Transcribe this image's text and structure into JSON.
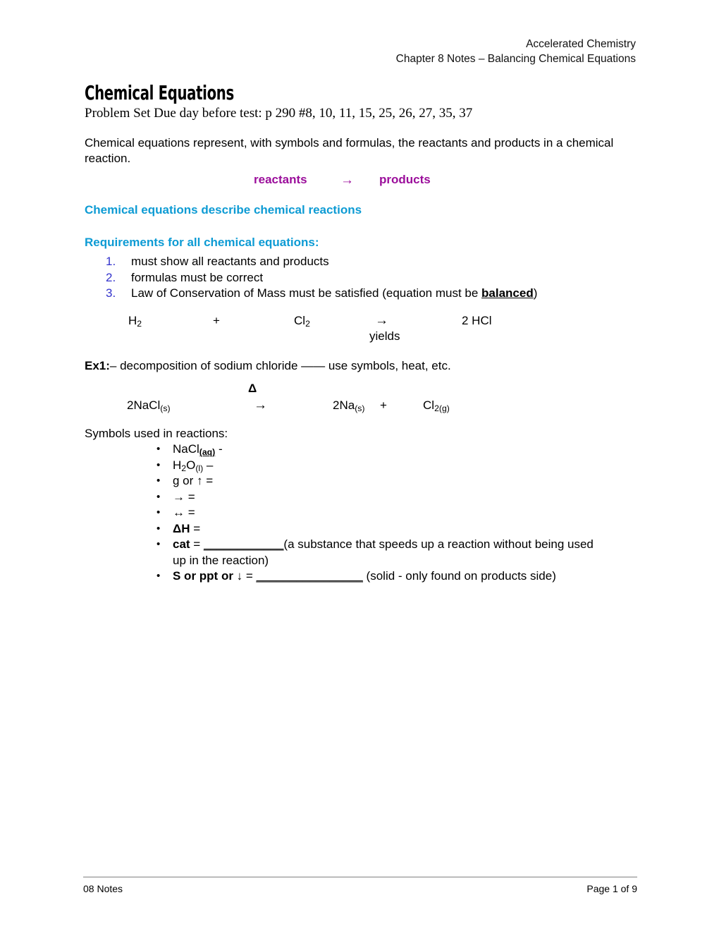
{
  "header": {
    "line1": "Accelerated Chemistry",
    "line2": "Chapter 8 Notes – Balancing Chemical Equations"
  },
  "title": {
    "heading": "Chemical Equations",
    "problem_set": "Problem Set Due day before test:  p 290 #8, 10, 11, 15, 25, 26, 27, 35, 37"
  },
  "intro": {
    "paragraph": "Chemical equations represent, with symbols and formulas, the reactants and products in a chemical reaction."
  },
  "reaction_line": {
    "reactants": "reactants",
    "arrow": "→",
    "products": "products",
    "color": "#9B0E9B"
  },
  "headings": {
    "describe": "Chemical equations describe chemical reactions",
    "requirements": "Requirements for all chemical equations:",
    "color": "#0D9BD4"
  },
  "requirements": {
    "number_color": "#3333CC",
    "items": [
      {
        "num": "1.",
        "text": "must show all reactants and products"
      },
      {
        "num": "2.",
        "text": "formulas must be correct"
      },
      {
        "num": "3.",
        "text_before": "Law of Conservation of Mass must be satisfied (equation must be ",
        "emphasis": "balanced",
        "text_after": ")"
      }
    ]
  },
  "equation_hcl": {
    "reactant1": "H",
    "reactant1_sub": "2",
    "plus": "+",
    "reactant2": "Cl",
    "reactant2_sub": "2",
    "arrow": "→",
    "arrow_label": "yields",
    "product": "2 HCl"
  },
  "example1": {
    "label": "Ex1:",
    "text": "– decomposition of sodium chloride —— use symbols, heat, etc."
  },
  "equation_nacl": {
    "condition": "Δ",
    "reactant": "2NaCl",
    "reactant_sub": "(s)",
    "arrow": "→",
    "product1": "2Na",
    "product1_sub": "(s)",
    "plus": "+",
    "product2": "Cl",
    "product2_sub": "2(g)"
  },
  "symbols": {
    "lead": "Symbols used in reactions:",
    "bullet_glyph": "•",
    "items": [
      {
        "id": "aq",
        "main": "NaCl",
        "sub": "(aq)",
        "sub_style": "bold-underline",
        "tail": "  -"
      },
      {
        "id": "l",
        "main": "H",
        "main_sub": "2",
        "main2": "O",
        "sub": "(l)",
        "tail": " –"
      },
      {
        "id": "gas",
        "text": " g or  ↑ ="
      },
      {
        "id": "yields",
        "text": "→   ="
      },
      {
        "id": "reversible",
        "text": "↔ ="
      },
      {
        "id": "enthalpy",
        "bold": "ΔH",
        "tail": " ="
      },
      {
        "id": "catalyst",
        "bold": "cat",
        "tail_before": " = ",
        "blank": "____________",
        "tail_after": "(a substance that speeds up a reaction without being used",
        "wrap": "up in the reaction)"
      },
      {
        "id": "precipitate",
        "bold": "S or ppt or ↓",
        "tail_before": " = ",
        "blank": "________________",
        "tail_after": " (solid - only found on products side)"
      }
    ]
  },
  "footer": {
    "left": "08 Notes",
    "right": "Page 1 of 9"
  }
}
